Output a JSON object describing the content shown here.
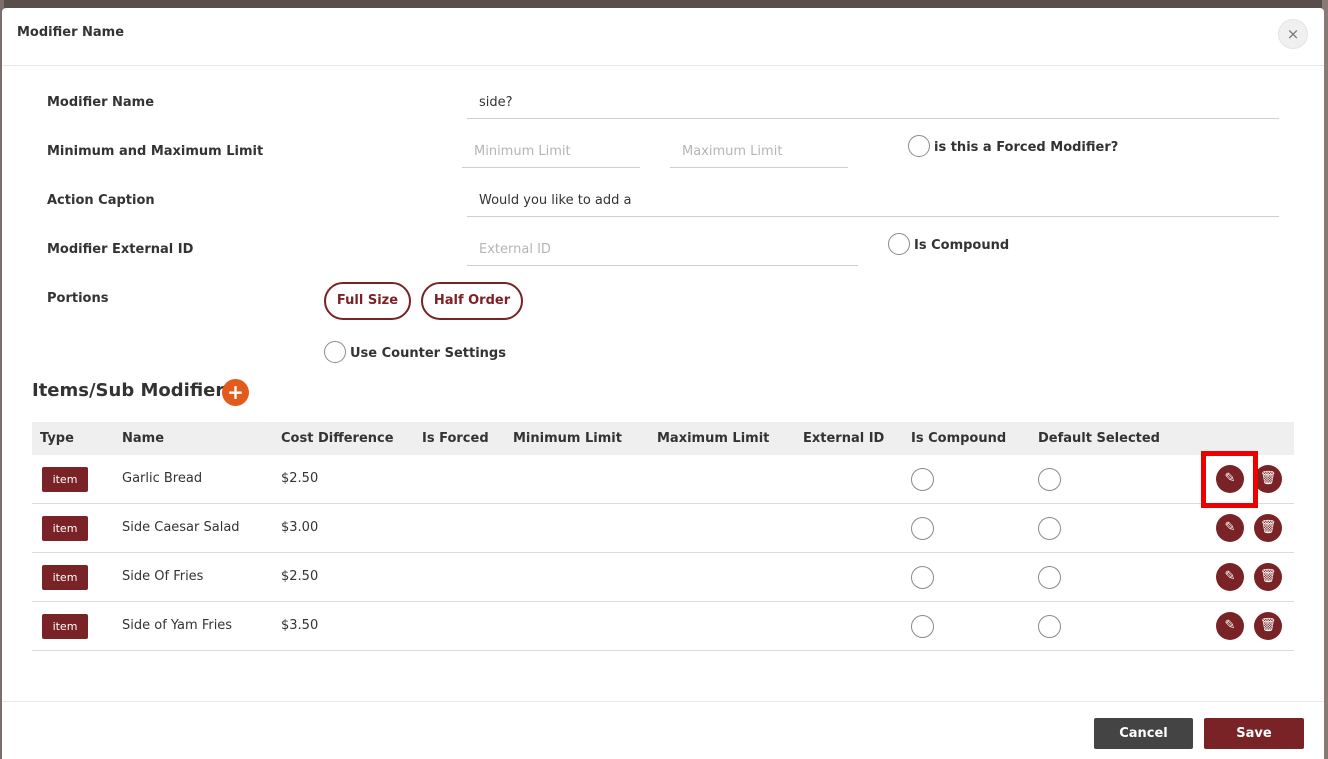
{
  "modal": {
    "title": "Modifier Name",
    "close_symbol": "×"
  },
  "form": {
    "modifier_name_label": "Modifier Name",
    "modifier_name_value": "side?",
    "limits_label": "Minimum and Maximum Limit",
    "min_placeholder": "Minimum Limit",
    "max_placeholder": "Maximum Limit",
    "forced_label": "is this a Forced Modifier?",
    "action_caption_label": "Action Caption",
    "action_caption_value": "Would you like to add a",
    "external_id_label": "Modifier External ID",
    "external_id_placeholder": "External ID",
    "compound_label": "Is Compound",
    "portions_label": "Portions",
    "portions": [
      "Full Size",
      "Half Order"
    ],
    "counter_settings_label": "Use Counter Settings"
  },
  "items_section": {
    "title": "Items/Sub Modifiers",
    "add_symbol": "+"
  },
  "table": {
    "headers": [
      "Type",
      "Name",
      "Cost Difference",
      "Is Forced",
      "Minimum Limit",
      "Maximum Limit",
      "External ID",
      "Is Compound",
      "Default Selected"
    ],
    "rows": [
      {
        "type": "item",
        "name": "Garlic Bread",
        "cost": "$2.50"
      },
      {
        "type": "item",
        "name": "Side Caesar Salad",
        "cost": "$3.00"
      },
      {
        "type": "item",
        "name": "Side Of Fries",
        "cost": "$2.50"
      },
      {
        "type": "item",
        "name": "Side of Yam Fries",
        "cost": "$3.50"
      }
    ]
  },
  "footer": {
    "cancel_label": "Cancel",
    "save_label": "Save"
  },
  "colors": {
    "brand": "#7a2326",
    "add_button": "#e25a1c",
    "highlight": "#ee0000",
    "cancel_button": "#444444"
  },
  "icons": {
    "edit": "pencil-icon",
    "delete": "trash-icon",
    "close": "close-icon",
    "add": "plus-icon"
  }
}
